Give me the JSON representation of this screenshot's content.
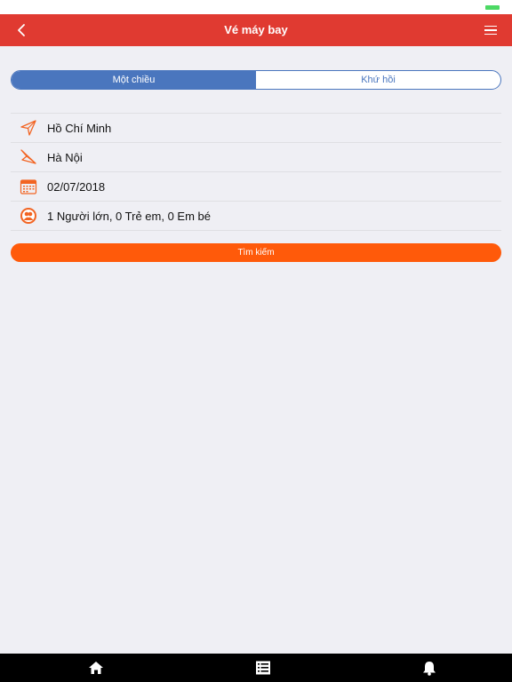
{
  "colors": {
    "nav_bar": "#e03a31",
    "segment_accent": "#4a76be",
    "search_button": "#ff5a0a",
    "icon_accent": "#f26422",
    "battery": "#4cd964",
    "tab_bar": "#000000",
    "background": "#efeff4"
  },
  "header": {
    "title": "Vé máy bay",
    "back_icon": "chevron-left-icon",
    "menu_icon": "hamburger-menu-icon"
  },
  "trip_type": {
    "options": [
      "Một chiều",
      "Khứ hồi"
    ],
    "selected": "Một chiều"
  },
  "form": {
    "origin": {
      "icon": "departure-plane-icon",
      "value": "Hồ Chí Minh"
    },
    "destination": {
      "icon": "arrival-plane-icon",
      "value": "Hà Nội"
    },
    "date": {
      "icon": "calendar-icon",
      "value": "02/07/2018"
    },
    "passengers": {
      "icon": "passengers-icon",
      "value": "1 Người lớn, 0 Trẻ em, 0 Em bé"
    }
  },
  "search_button": {
    "label": "Tìm kiếm"
  },
  "tab_bar": {
    "items": [
      {
        "icon": "home-icon"
      },
      {
        "icon": "list-icon"
      },
      {
        "icon": "bell-icon"
      }
    ]
  }
}
